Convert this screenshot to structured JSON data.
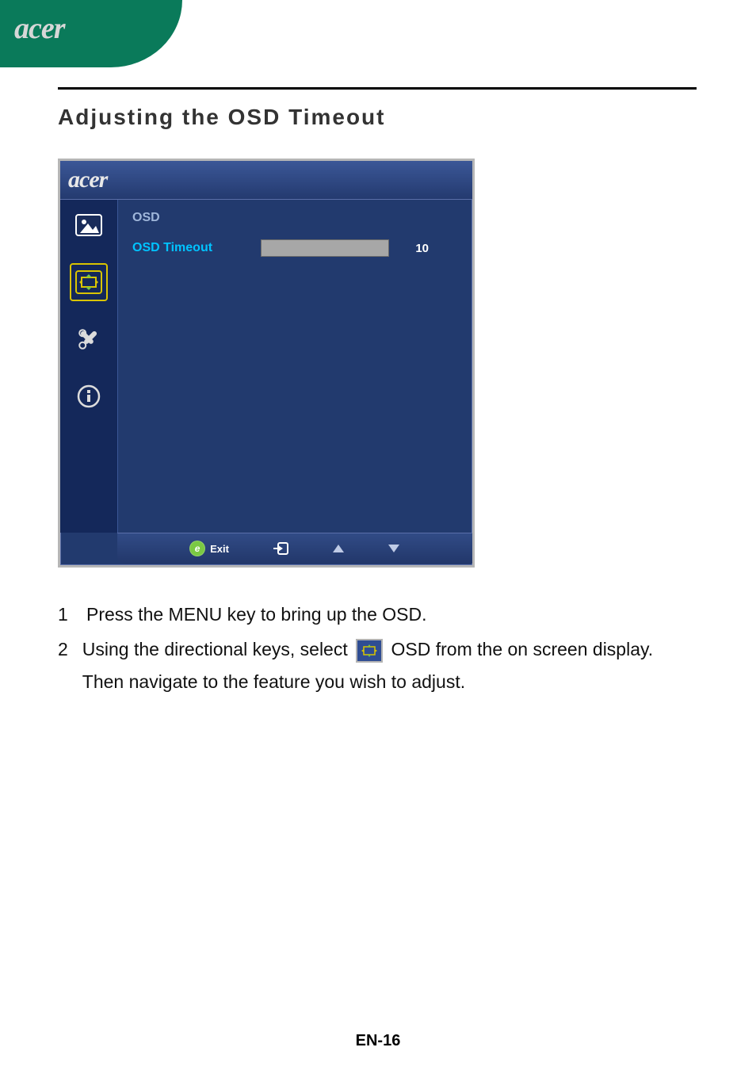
{
  "header": {
    "brand": "acer"
  },
  "section_title": "Adjusting the OSD Timeout",
  "osd": {
    "brand": "acer",
    "sidebar": {
      "items": [
        {
          "name": "picture-icon"
        },
        {
          "name": "osd-settings-icon",
          "selected": true
        },
        {
          "name": "tools-icon"
        },
        {
          "name": "info-icon"
        }
      ]
    },
    "content": {
      "title": "OSD",
      "row_label": "OSD Timeout",
      "row_value": "10"
    },
    "footer": {
      "e_label": "e",
      "exit_label": "Exit"
    }
  },
  "instructions": {
    "step1_num": "1",
    "step1_text": "Press the MENU key to bring up the OSD.",
    "step2_num": "2",
    "step2_text_a": "Using the directional keys, select ",
    "step2_text_b": " OSD from the on screen display. Then navigate to the feature you wish to adjust."
  },
  "page_number": "EN-16"
}
